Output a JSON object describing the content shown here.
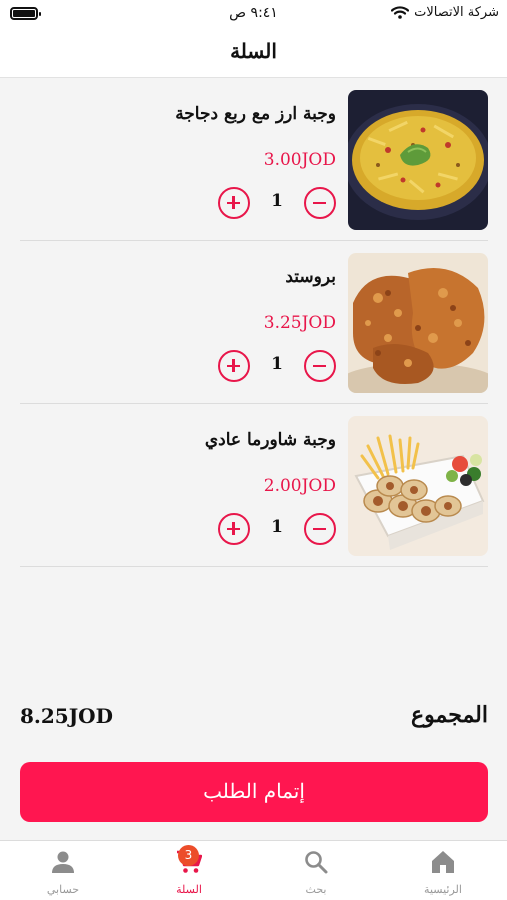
{
  "status_bar": {
    "carrier": "شركة الاتصالات",
    "time": "٩:٤١ ص"
  },
  "header": {
    "title": "السلة"
  },
  "cart": {
    "items": [
      {
        "name": "وجبة ارز مع ربع دجاجة",
        "price": "3.00JOD",
        "quantity": "1",
        "image": "rice-chicken-meal"
      },
      {
        "name": "بروستد",
        "price": "3.25JOD",
        "quantity": "1",
        "image": "broasted-chicken"
      },
      {
        "name": "وجبة شاورما عادي",
        "price": "2.00JOD",
        "quantity": "1",
        "image": "shawarma-meal"
      }
    ]
  },
  "summary": {
    "total_label": "المجموع",
    "total_amount": "8.25JOD"
  },
  "checkout": {
    "label": "إتمام الطلب"
  },
  "tabbar": {
    "tabs": [
      {
        "label": "الرئيسية",
        "icon": "home-icon"
      },
      {
        "label": "بحث",
        "icon": "search-icon"
      },
      {
        "label": "السلة",
        "icon": "cart-icon",
        "badge": "3",
        "active": true
      },
      {
        "label": "حسابي",
        "icon": "account-icon"
      }
    ]
  },
  "colors": {
    "accent": "#ff1650",
    "price": "#e8164a",
    "badge": "#ec4d2a"
  }
}
